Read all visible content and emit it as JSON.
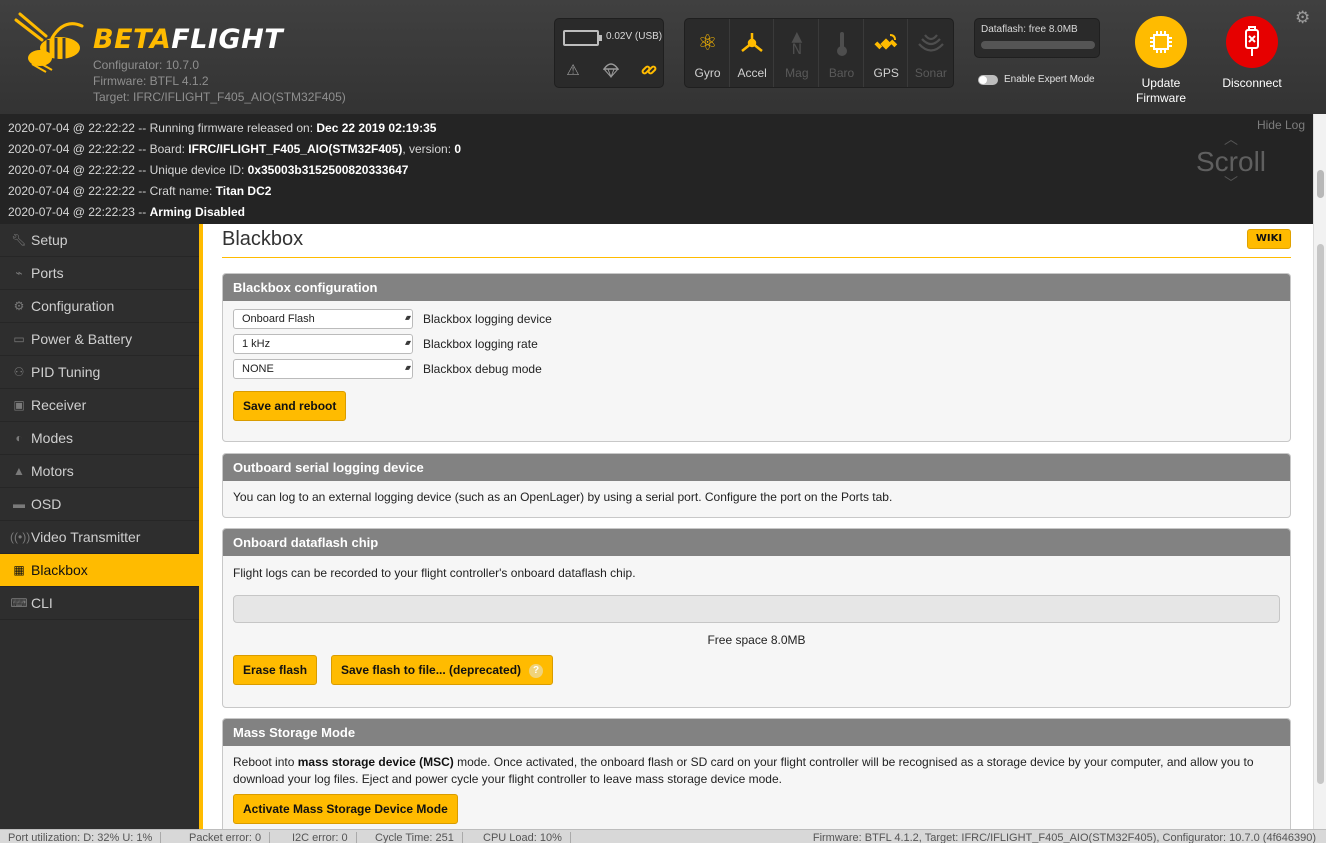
{
  "header": {
    "brand_beta": "BETA",
    "brand_flight": "FLIGHT",
    "configurator": "Configurator: 10.7.0",
    "firmware": "Firmware: BTFL 4.1.2",
    "target": "Target: IFRC/IFLIGHT_F405_AIO(STM32F405)",
    "battery_text": "0.02V (USB)",
    "battery_icons": [
      "warning-icon",
      "parachute-icon",
      "link-icon"
    ],
    "sensors": [
      {
        "label": "Gyro",
        "icon": "gyro-icon",
        "active": true
      },
      {
        "label": "Accel",
        "icon": "accel-icon",
        "active": true
      },
      {
        "label": "Mag",
        "icon": "mag-icon",
        "active": false
      },
      {
        "label": "Baro",
        "icon": "baro-icon",
        "active": false
      },
      {
        "label": "GPS",
        "icon": "gps-icon",
        "active": true
      },
      {
        "label": "Sonar",
        "icon": "sonar-icon",
        "active": false
      }
    ],
    "dataflash": "Dataflash: free 8.0MB",
    "expert_mode": "Enable Expert Mode",
    "update_firmware_line1": "Update",
    "update_firmware_line2": "Firmware",
    "disconnect": "Disconnect",
    "accent_color": "#ffbb00",
    "disconnect_color": "#e60000"
  },
  "log": {
    "hide_label": "Hide Log",
    "scroll_label": "Scroll",
    "lines": [
      {
        "prefix": "2020-07-04 @ 22:22:22 -- Running firmware released on: ",
        "bold": "Dec 22 2019 02:19:35",
        "suffix": ""
      },
      {
        "prefix": "2020-07-04 @ 22:22:22 -- Board: ",
        "bold": "IFRC/IFLIGHT_F405_AIO(STM32F405)",
        "suffix": ", version: ",
        "bold2": "0"
      },
      {
        "prefix": "2020-07-04 @ 22:22:22 -- Unique device ID: ",
        "bold": "0x35003b3152500820333647",
        "suffix": ""
      },
      {
        "prefix": "2020-07-04 @ 22:22:22 -- Craft name: ",
        "bold": "Titan DC2",
        "suffix": ""
      },
      {
        "prefix": "2020-07-04 @ 22:22:23 -- ",
        "bold": "Arming Disabled",
        "suffix": ""
      }
    ]
  },
  "sidebar": {
    "items": [
      {
        "label": "Setup",
        "icon": "wrench-icon"
      },
      {
        "label": "Ports",
        "icon": "plug-icon"
      },
      {
        "label": "Configuration",
        "icon": "gear-icon"
      },
      {
        "label": "Power & Battery",
        "icon": "battery-icon"
      },
      {
        "label": "PID Tuning",
        "icon": "pid-icon"
      },
      {
        "label": "Receiver",
        "icon": "receiver-icon"
      },
      {
        "label": "Modes",
        "icon": "modes-icon"
      },
      {
        "label": "Motors",
        "icon": "motor-icon"
      },
      {
        "label": "OSD",
        "icon": "osd-icon"
      },
      {
        "label": "Video Transmitter",
        "icon": "vtx-icon"
      },
      {
        "label": "Blackbox",
        "icon": "blackbox-icon",
        "active": true
      },
      {
        "label": "CLI",
        "icon": "cli-icon"
      }
    ]
  },
  "main": {
    "title": "Blackbox",
    "wiki": "WIKI",
    "config_panel": {
      "header": "Blackbox configuration",
      "rows": [
        {
          "value": "Onboard Flash",
          "label": "Blackbox logging device"
        },
        {
          "value": "1 kHz",
          "label": "Blackbox logging rate"
        },
        {
          "value": "NONE",
          "label": "Blackbox debug mode"
        }
      ],
      "save_button": "Save and reboot"
    },
    "serial_panel": {
      "header": "Outboard serial logging device",
      "text": "You can log to an external logging device (such as an OpenLager) by using a serial port. Configure the port on the Ports tab."
    },
    "dataflash_panel": {
      "header": "Onboard dataflash chip",
      "text": "Flight logs can be recorded to your flight controller's onboard dataflash chip.",
      "used_fraction": 0,
      "free_space": "Free space 8.0MB",
      "erase_button": "Erase flash",
      "save_button": "Save flash to file... (deprecated)",
      "help": "?"
    },
    "msc_panel": {
      "header": "Mass Storage Mode",
      "text_prefix": "Reboot into ",
      "text_bold": "mass storage device (MSC)",
      "text_suffix": " mode. Once activated, the onboard flash or SD card on your flight controller will be recognised as a storage device by your computer, and allow you to download your log files. Eject and power cycle your flight controller to leave mass storage device mode.",
      "button": "Activate Mass Storage Device Mode"
    }
  },
  "status": {
    "port_util": "Port utilization: D: 32% U: 1%",
    "packet_error": "Packet error: 0",
    "i2c_error": "I2C error: 0",
    "cycle_time": "Cycle Time: 251",
    "cpu_load": "CPU Load: 10%",
    "right": "Firmware: BTFL 4.1.2, Target: IFRC/IFLIGHT_F405_AIO(STM32F405), Configurator: 10.7.0 (4f646390)"
  }
}
